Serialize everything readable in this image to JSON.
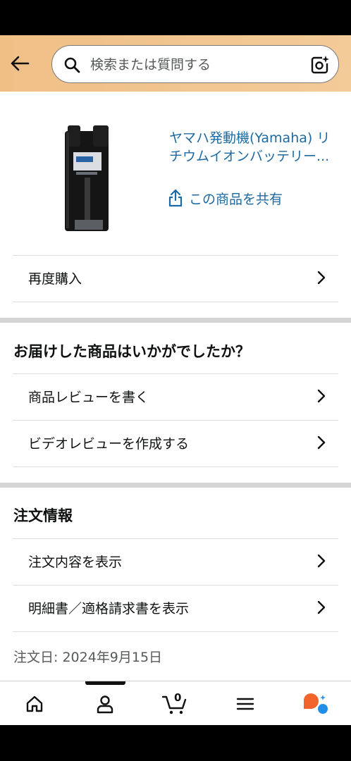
{
  "header": {
    "search_placeholder": "検索または質問する",
    "back_icon": "back-arrow-icon",
    "search_icon": "search-icon",
    "camera_icon": "camera-sparkle-icon"
  },
  "product": {
    "title": "ヤマハ発動機(Yamaha) リチウムイオンバッテリー...",
    "share_label": "この商品を共有"
  },
  "rebuy": {
    "label": "再度購入"
  },
  "feedback": {
    "heading": "お届けした商品はいかがでしたか？",
    "items": [
      {
        "label": "商品レビューを書く"
      },
      {
        "label": "ビデオレビューを作成する"
      }
    ]
  },
  "order_info": {
    "heading": "注文情報",
    "items": [
      {
        "label": "注文内容を表示"
      },
      {
        "label": "明細書／適格請求書を表示"
      }
    ],
    "order_date": "注文日: 2024年9月15日"
  },
  "bottom_nav": {
    "cart_count": "0",
    "items": [
      "home-icon",
      "account-icon",
      "cart-icon",
      "menu-icon",
      "rufus-ai-icon"
    ]
  },
  "colors": {
    "header_bg": "#efbf86",
    "link": "#1d6aa3",
    "ai_orange": "#f2642b",
    "ai_blue": "#1f8fe8"
  }
}
